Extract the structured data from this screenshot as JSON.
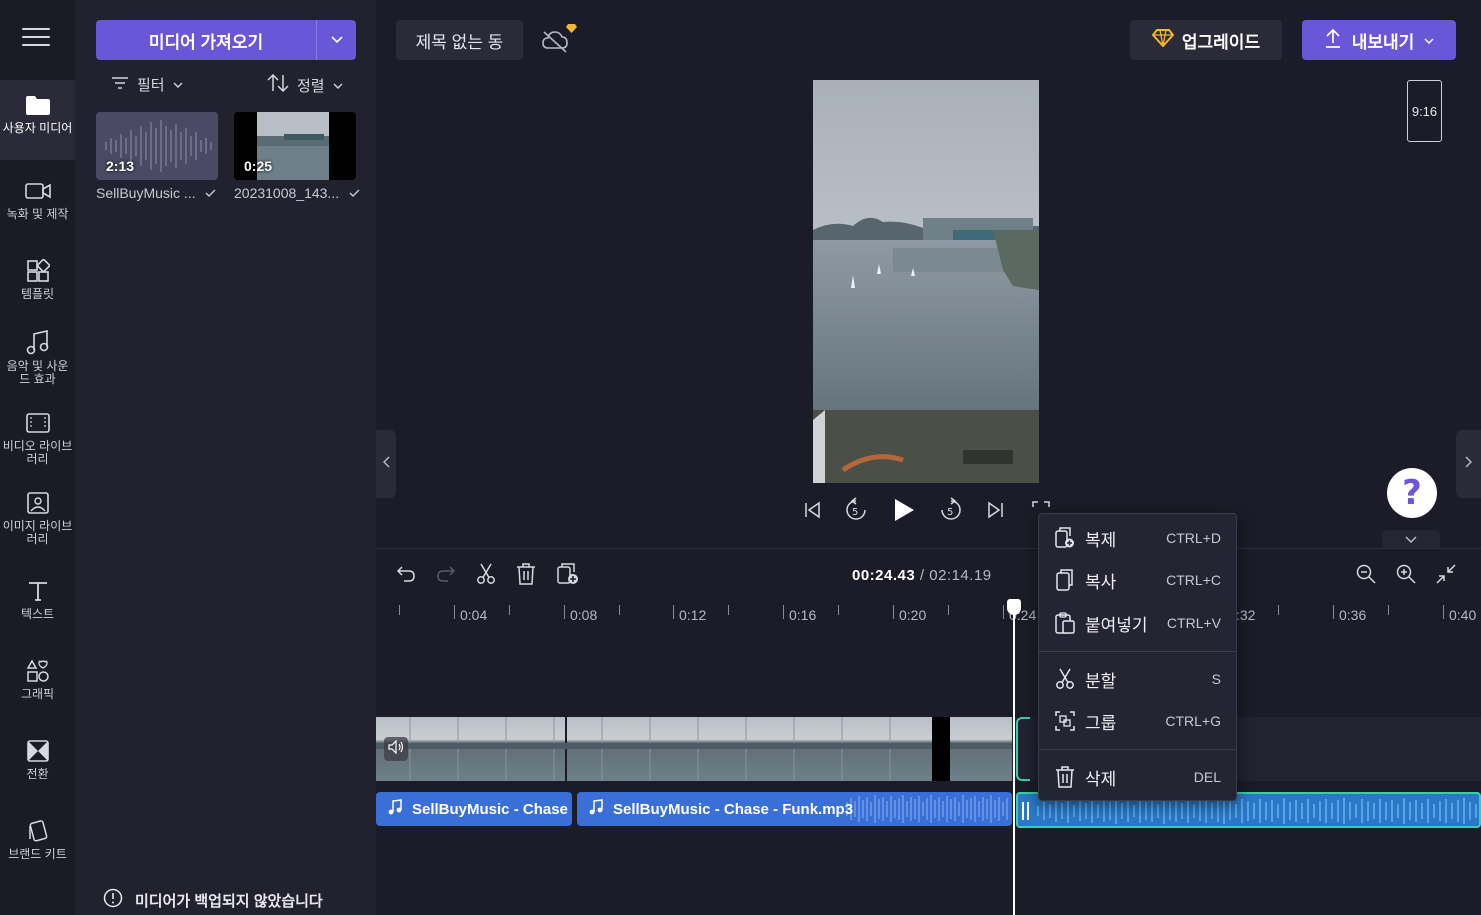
{
  "colors": {
    "accent": "#6a57d8",
    "selection": "#38d0a8",
    "audio": "#3a6fd8",
    "upgrade_gem": "#f5b731"
  },
  "sidebar": {
    "items": [
      {
        "label": "사용자 미디어",
        "icon": "folder-icon"
      },
      {
        "label": "녹화 및 제작",
        "icon": "camera-icon"
      },
      {
        "label": "템플릿",
        "icon": "templates-icon"
      },
      {
        "label": "음악 및 사운드 효과",
        "icon": "music-icon"
      },
      {
        "label": "비디오 라이브러리",
        "icon": "film-icon"
      },
      {
        "label": "이미지 라이브러리",
        "icon": "image-icon"
      },
      {
        "label": "텍스트",
        "icon": "text-icon"
      },
      {
        "label": "그래픽",
        "icon": "shapes-icon"
      },
      {
        "label": "전환",
        "icon": "transition-icon"
      },
      {
        "label": "브랜드 키트",
        "icon": "brand-kit-icon"
      }
    ]
  },
  "media": {
    "import_label": "미디어 가져오기",
    "filter_label": "필터",
    "sort_label": "정렬",
    "assets": [
      {
        "duration": "2:13",
        "name": "SellBuyMusic ..."
      },
      {
        "duration": "0:25",
        "name": "20231008_143..."
      }
    ],
    "backup_note": "미디어가 백업되지 않았습니다"
  },
  "header": {
    "project_title": "제목 없는 동",
    "upgrade_label": "업그레이드",
    "export_label": "내보내기",
    "aspect_ratio": "9:16"
  },
  "player": {
    "help_glyph": "?"
  },
  "timeline": {
    "current_time": "00:24.43",
    "separator": " / ",
    "total_time": "02:14.19",
    "ruler_labels": [
      "0:04",
      "0:08",
      "0:12",
      "0:16",
      "0:20",
      "0:24",
      ":32",
      "0:36",
      "0:40"
    ],
    "audio_clips": [
      {
        "label": "SellBuyMusic - Chase -"
      },
      {
        "label": "SellBuyMusic - Chase - Funk.mp3"
      }
    ]
  },
  "context_menu": {
    "items": [
      {
        "label": "복제",
        "shortcut": "CTRL+D",
        "icon": "duplicate-icon"
      },
      {
        "label": "복사",
        "shortcut": "CTRL+C",
        "icon": "copy-icon"
      },
      {
        "label": "붙여넣기",
        "shortcut": "CTRL+V",
        "icon": "paste-icon"
      },
      {
        "label": "분할",
        "shortcut": "S",
        "icon": "scissors-icon"
      },
      {
        "label": "그룹",
        "shortcut": "CTRL+G",
        "icon": "group-icon"
      },
      {
        "label": "삭제",
        "shortcut": "DEL",
        "icon": "trash-icon"
      }
    ]
  }
}
